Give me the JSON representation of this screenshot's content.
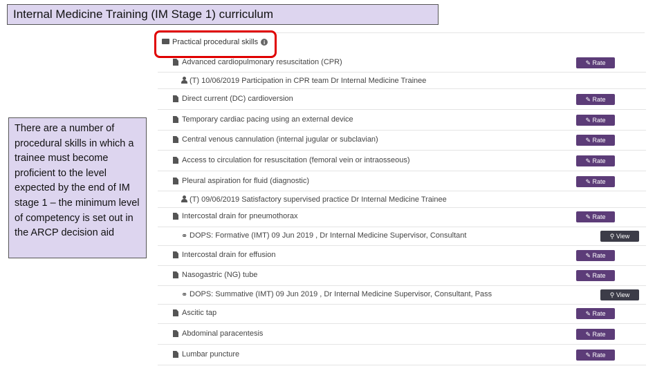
{
  "title": "Internal Medicine Training (IM Stage 1) curriculum",
  "note": "There are a number of procedural skills in which a trainee must become proficient to the level expected by the end of IM stage 1 – the minimum level of competency is set out in the ARCP decision aid",
  "section": {
    "label": "Practical procedural skills",
    "info_icon": "info-icon",
    "highlight_color": "#e00000"
  },
  "buttons": {
    "rate": "Rate",
    "view": "View"
  },
  "colors": {
    "rate_button": "#5c3c78",
    "view_button": "#3c3c48",
    "title_bg": "#ddd5ef"
  },
  "skills": [
    {
      "label": "Advanced cardiopulmonary resuscitation (CPR)"
    },
    {
      "label": "(T)    10/06/2019    Participation in CPR team    Dr Internal Medicine Trainee"
    },
    {
      "label": "Direct current (DC) cardioversion"
    },
    {
      "label": "Temporary cardiac pacing using an external device"
    },
    {
      "label": "Central venous cannulation (internal jugular or subclavian)"
    },
    {
      "label": "Access to circulation for resuscitation (femoral vein or intraosseous)"
    },
    {
      "label": "Pleural aspiration for fluid (diagnostic)"
    },
    {
      "label": "(T)    09/06/2019    Satisfactory supervised practice    Dr Internal Medicine Trainee"
    },
    {
      "label": "Intercostal drain for pneumothorax"
    },
    {
      "label": "DOPS: Formative (IMT) 09 Jun 2019 , Dr Internal Medicine Supervisor, Consultant"
    },
    {
      "label": "Intercostal drain for effusion"
    },
    {
      "label": "Nasogastric (NG) tube"
    },
    {
      "label": "DOPS: Summative (IMT) 09 Jun 2019 , Dr Internal Medicine Supervisor, Consultant, Pass"
    },
    {
      "label": "Ascitic tap"
    },
    {
      "label": "Abdominal paracentesis"
    },
    {
      "label": "Lumbar puncture"
    }
  ]
}
